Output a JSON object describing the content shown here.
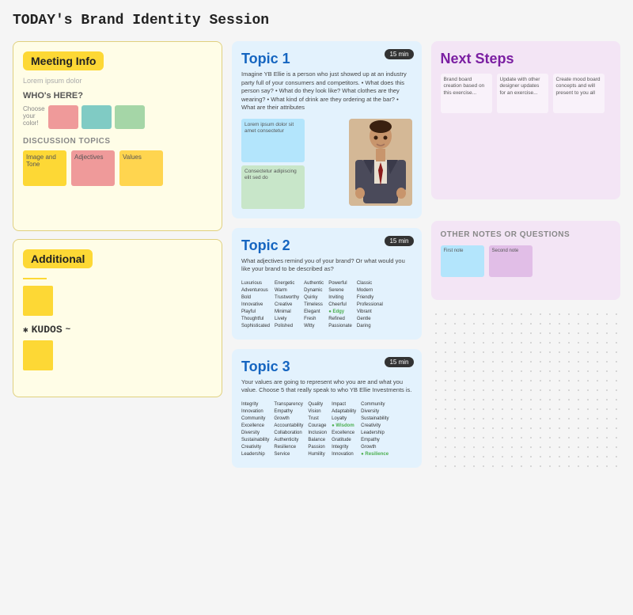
{
  "page": {
    "title": "TODAY's Brand Identity Session"
  },
  "left": {
    "meeting_info": {
      "header": "Meeting Info",
      "subtitle": "Lorem ipsum dolor",
      "who_label": "WHO's HERE?",
      "choose_label": "Choose\nyour\ncolor!",
      "swatches": [
        "#ef9a9a",
        "#80cbc4",
        "#a5d6a7"
      ],
      "discussion_label": "DISCUSSION TOPICS",
      "discussion_items": [
        {
          "label": "Image and Tone",
          "color": "#fdd835"
        },
        {
          "label": "Adjectives",
          "color": "#ef9a9a"
        },
        {
          "label": "Values",
          "color": "#ffd54f"
        }
      ]
    },
    "additional": {
      "header": "Additional",
      "line": "___"
    },
    "kudos": {
      "text": "KUDOS",
      "sticky_color": "#fdd835"
    }
  },
  "middle": {
    "topic1": {
      "header": "Topic 1",
      "timer": "15 min",
      "body": "Imagine YB Ellie is a person who just showed up at an industry party full of your consumers and competitors.\n• What does this person say?\n• What do they look like? What clothes are they wearing?\n• What kind of drink are they ordering at the bar?\n• What are their attributes",
      "sticky_notes": [
        {
          "text": "Lorem ipsum dolor sit amet",
          "color": "#b3e5fc"
        },
        {
          "text": "Consectetur adipiscing",
          "color": "#c8e6c9"
        }
      ]
    },
    "topic2": {
      "header": "Topic 2",
      "timer": "15 min",
      "body": "What adjectives remind you of your brand? Or what would you like your brand to be described as?",
      "adjectives": [
        "Luxurious",
        "Adventurous",
        "Bold",
        "Innovative",
        "Playful",
        "Thoughtful",
        "Sophisticated",
        "Energetic",
        "Warm",
        "Trustworthy",
        "Creative",
        "Minimal",
        "Lively",
        "Polished",
        "Authentic",
        "Dynamic",
        "Quirky",
        "Timeless",
        "Elegant",
        "Fresh",
        "Witty",
        "Powerful",
        "Serene",
        "Inviting",
        "Cheerful",
        "Edgy",
        "Refined",
        "Passionate",
        "Classic",
        "Modern",
        "Friendly",
        "Professional",
        "Vibrant",
        "Gentle",
        "Daring"
      ]
    },
    "topic3": {
      "header": "Topic 3",
      "timer": "15 min",
      "body": "Your values are going to represent who you are and what you value. Choose 5 that really speak to who YB Ellie Investments is.",
      "values": [
        "Integrity",
        "Innovation",
        "Community",
        "Excellence",
        "Diversity",
        "Sustainability",
        "Creativity",
        "Leadership",
        "Transparency",
        "Empathy",
        "Growth",
        "Accountability",
        "Collaboration",
        "Authenticity",
        "Resilience",
        "Service",
        "Quality",
        "Vision",
        "Trust",
        "Courage",
        "Inclusion",
        "Balance",
        "Passion",
        "Humility",
        "Impact",
        "Adaptability",
        "Loyalty",
        "Wisdom",
        "Excellence",
        "Gratitude"
      ]
    }
  },
  "right": {
    "next_steps": {
      "header": "Next Steps",
      "items": [
        {
          "label": "Brand board creation based on this exercise..."
        },
        {
          "label": "Update with other designer updates for an exercise..."
        },
        {
          "label": "Create mood board concepts and will present to you all"
        }
      ]
    },
    "other_notes": {
      "header": "OTHER NOTES OR QUESTIONS",
      "items": [
        {
          "label": "First note",
          "color": "#b3e5fc"
        },
        {
          "label": "Second note",
          "color": "#e1bee7"
        }
      ]
    }
  }
}
